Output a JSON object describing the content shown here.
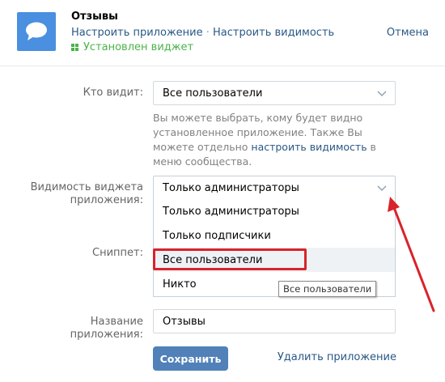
{
  "app": {
    "title": "Отзывы",
    "link_configure": "Настроить приложение",
    "separator": " · ",
    "link_visibility": "Настроить видимость",
    "status": "Установлен виджет",
    "cancel": "Отмена"
  },
  "form": {
    "who_sees_label": "Кто видит:",
    "who_sees_value": "Все пользователи",
    "hint_before": "Вы можете выбрать, кому будет видно установленное приложение. Также Вы можете отдельно ",
    "hint_link": "настроить видимость",
    "hint_after": " в меню сообщества.",
    "widget_visibility_label_1": "Видимость виджета",
    "widget_visibility_label_2": "приложения:",
    "widget_visibility_value": "Только администраторы",
    "dropdown_options": [
      "Только администраторы",
      "Только подписчики",
      "Все пользователи",
      "Никто"
    ],
    "tooltip": "Все пользователи",
    "snippet_label": "Сниппет:",
    "app_name_label": "Название приложения:",
    "app_name_value": "Отзывы",
    "save_label": "Сохранить",
    "delete_label": "Удалить приложение"
  },
  "colors": {
    "accent": "#5181b8",
    "link": "#2a5885",
    "status_green": "#4bb34b",
    "annotation_red": "#d9232b"
  }
}
